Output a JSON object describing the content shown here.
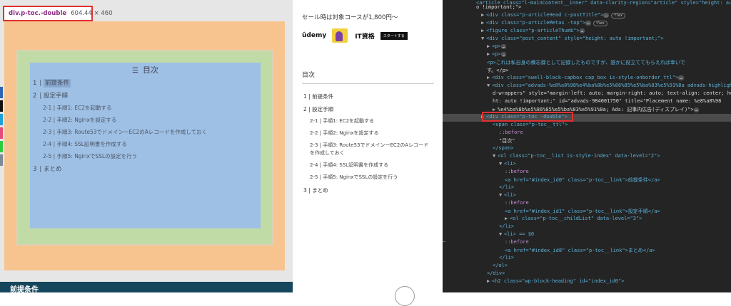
{
  "tooltip": {
    "selector": "div.p-toc.-double",
    "dimensions": "604.44 × 460"
  },
  "toc": {
    "title": "目次",
    "items": [
      {
        "num": "1",
        "text": "前提条件"
      },
      {
        "num": "2",
        "text": "設定手順"
      },
      {
        "num": "3",
        "text": "まとめ"
      }
    ],
    "sub_items": [
      {
        "num": "2-1",
        "text": "手順1: EC2を起動する"
      },
      {
        "num": "2-2",
        "text": "手順2: Nginxを設定する"
      },
      {
        "num": "2-3",
        "text": "手順3: Route53でドメインーEC2のAレコードを作成しておく"
      },
      {
        "num": "2-4",
        "text": "手順4: SSL証明書を作成する"
      },
      {
        "num": "2-5",
        "text": "手順5: NginxでSSLの設定を行う"
      }
    ]
  },
  "bottom_heading": "前提条件",
  "sidebar": {
    "sale_text": "セール時は対象コースが1,800円〜",
    "ad_brand": "ûdemy",
    "ad_tag": "IT資格",
    "ad_badge": "スタートする",
    "toc_heading": "目次",
    "items": [
      {
        "num": "1",
        "text": "前提条件"
      },
      {
        "num": "2",
        "text": "設定手順"
      },
      {
        "num": "3",
        "text": "まとめ"
      }
    ],
    "sub_items": [
      {
        "num": "2-1",
        "text": "手順1: EC2を起動する"
      },
      {
        "num": "2-2",
        "text": "手順2: Nginxを設定する"
      },
      {
        "num": "2-3",
        "text": "手順3: Route53でドメインーEC2のAレコードを作成しておく"
      },
      {
        "num": "2-4",
        "text": "手順4: SSL証明書を作成する"
      },
      {
        "num": "2-5",
        "text": "手順5: NginxでSSLの設定を行う"
      }
    ]
  },
  "devtools": {
    "lines": [
      "<article class=\"l-mainContent__inner\" data-clarity-region=\"article\" style=\"height: aut",
      "o !important;\">",
      "<div class=\"p-articleHead c-postTitle\">",
      "<div class=\"p-articleMetas -top\">",
      "<figure class=\"p-articleThumb\">",
      "<div class=\"post_content\" style=\"height: auto !important;\">",
      "<p>",
      "<p>",
      "<p>これは私自身の備忘録として記録したものですが、誰かに役立ててもらえれば幸いで",
      "す。</p>",
      "<div class=\"swell-block-capbox cap_box is-style-onborder_ttl\">",
      "<div class=\"advads-%e8%a8%98%e4%ba%8b%e5%86%85%e5%ba%83%e5%91%8a advads-highlighte",
      "d-wrappers\" style=\"margin-left: auto; margin-right: auto; text-align: center; heig",
      "ht: auto !important;\" id=\"advads-984001750\" title=\"Placement name: %e8%a8%98",
      "%e4%ba%8b%e5%86%85%e5%ba%83%e5%91%8a; Ads: 記事内広告(ディスプレイ)\">",
      "<div class=\"p-toc -double\">",
      "<span class=\"p-toc__ttl\">",
      "::before",
      "\"目次\"",
      "</span>",
      "<ol class=\"p-toc__list is-style-index\" data-level=\"2\">",
      "<li>",
      "::before",
      "<a href=\"#index_id0\" class=\"p-toc__link\">前提条件</a>",
      "</li>",
      "<li>",
      "::before",
      "<a href=\"#index_id1\" class=\"p-toc__link\">設定手順</a>",
      "<ol class=\"p-toc__childList\" data-level=\"3\">",
      "</li>",
      "<li> == $0",
      "::before",
      "<a href=\"#index_id8\" class=\"p-toc__link\">まとめ</a>",
      "</li>",
      "</ol>",
      "</div>",
      "<h2 class=\"wp-block-heading\" id=\"index_id0\">"
    ],
    "flex_badge": "flex",
    "ellipsis": "…",
    "gutter": "…"
  },
  "colors": {
    "margin": "#f7c48f",
    "padding": "#c0dba6",
    "content": "#9fc0e5",
    "highlight": "#e03131",
    "side_icons": [
      "#2a64b4",
      "#111111",
      "#1ea0d8",
      "#e64a7a",
      "#2ecc40",
      "#7a8a99"
    ]
  }
}
